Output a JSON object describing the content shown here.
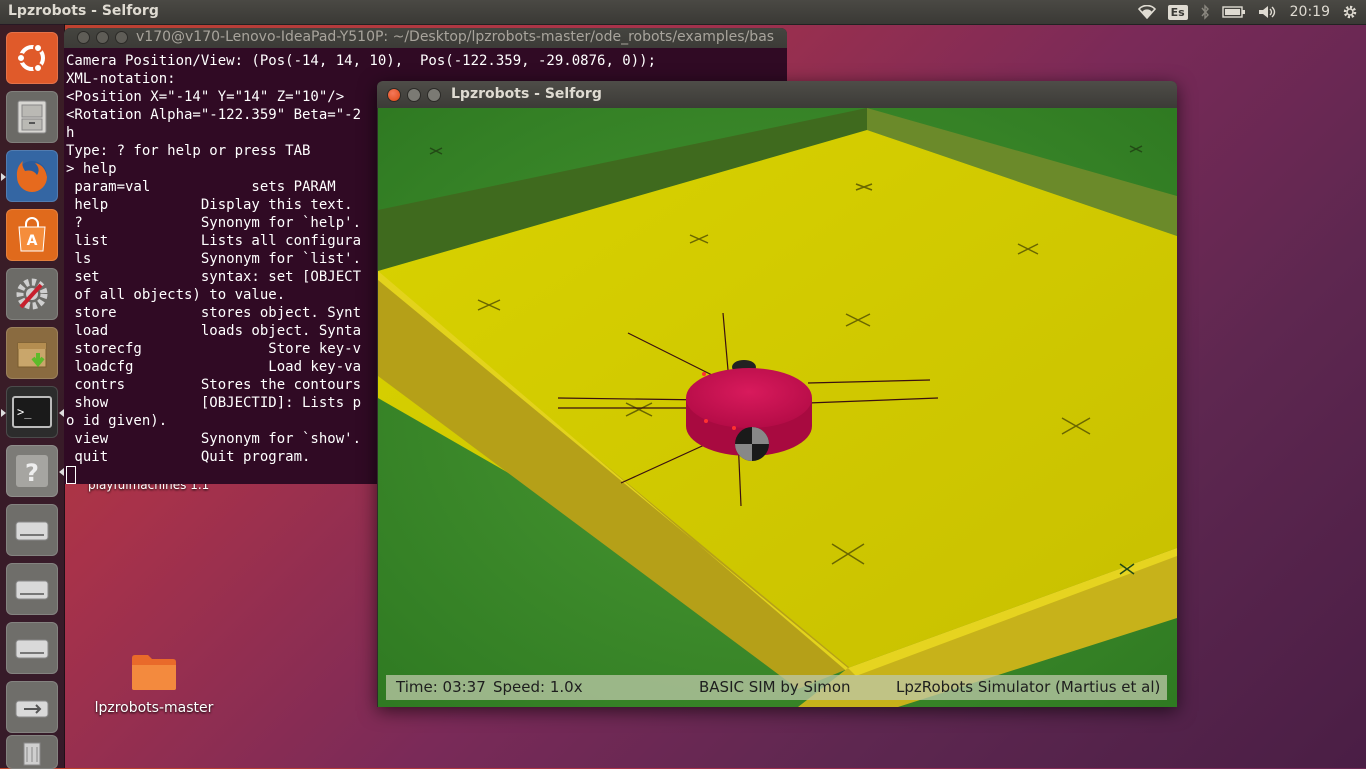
{
  "top_panel": {
    "app_title": "Lpzrobots - Selforg",
    "keyboard_layout": "Es",
    "clock": "20:19",
    "icons": [
      "wifi-icon",
      "keyboard-layout-icon",
      "bluetooth-icon",
      "battery-icon",
      "volume-icon",
      "settings-gear-icon"
    ]
  },
  "launcher": {
    "items": [
      {
        "name": "ubuntu-dash"
      },
      {
        "name": "files"
      },
      {
        "name": "firefox"
      },
      {
        "name": "software-center"
      },
      {
        "name": "system-settings"
      },
      {
        "name": "archive-manager"
      },
      {
        "name": "terminal"
      },
      {
        "name": "help"
      },
      {
        "name": "drive-1"
      },
      {
        "name": "drive-2"
      },
      {
        "name": "drive-3"
      },
      {
        "name": "usb-drive"
      },
      {
        "name": "trash"
      }
    ]
  },
  "desktop": {
    "folder_label": "lpzrobots-master",
    "partial_label": "playfulmachines 1.1"
  },
  "terminal": {
    "title": "v170@v170-Lenovo-IdeaPad-Y510P: ~/Desktop/lpzrobots-master/ode_robots/examples/bas",
    "lines": [
      "Camera Position/View: (Pos(-14, 14, 10),  Pos(-122.359, -29.0876, 0));",
      "XML-notation:",
      "<Position X=\"-14\" Y=\"14\" Z=\"10\"/>",
      "<Rotation Alpha=\"-122.359\" Beta=\"-2",
      "h",
      "Type: ? for help or press TAB",
      "> help",
      " param=val            sets PARAM",
      " help           Display this text.",
      " ?              Synonym for `help'.",
      " list           Lists all configura",
      " ls             Synonym for `list'.",
      " set            syntax: set [OBJECT",
      " of all objects) to value.",
      " store          stores object. Synt",
      " load           loads object. Synta",
      " storecfg               Store key-v",
      " loadcfg                Load key-va",
      " contrs         Stores the contours",
      " show           [OBJECTID]: Lists p",
      "o id given).",
      " view           Synonym for `show'.",
      " quit           Quit program."
    ]
  },
  "game_window": {
    "title": "Lpzrobots - Selforg",
    "status": {
      "time": "Time: 03:37",
      "speed": "Speed: 1.0x",
      "sim_name": "BASIC SIM by Simon",
      "simulator": "LpzRobots Simulator (Martius et al)"
    }
  },
  "colors": {
    "terminal_bg": "#300a24",
    "floor_yellow": "#d8d400",
    "grass_green": "#3d8a2a",
    "robot_red": "#c8104e",
    "ubuntu_orange": "#dd4814"
  }
}
